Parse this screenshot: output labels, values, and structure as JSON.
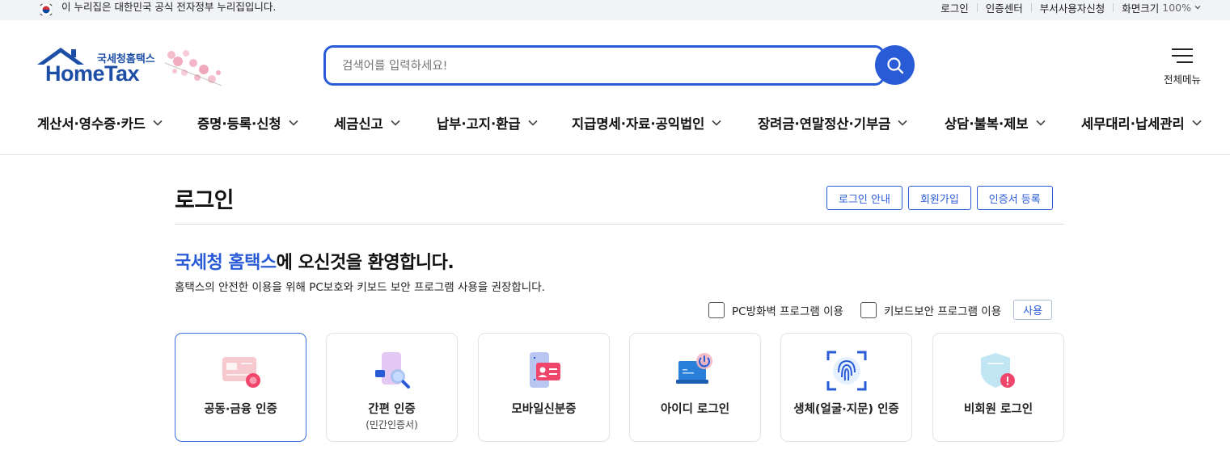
{
  "gov_bar": {
    "notice": "이 누리집은 대한민국 공식 전자정부 누리집입니다.",
    "links": [
      "로그인",
      "인증센터",
      "부서사용자신청"
    ],
    "zoom_label": "화면크기",
    "zoom_value": "100%"
  },
  "header": {
    "logo_small": "국세청홈택스",
    "logo_main": "HomeTax",
    "search_placeholder": "검색어를 입력하세요!",
    "all_menu_label": "전체메뉴"
  },
  "nav": {
    "items": [
      "계산서·영수증·카드",
      "증명·등록·신청",
      "세금신고",
      "납부·고지·환급",
      "지급명세·자료·공익법인",
      "장려금·연말정산·기부금",
      "상담·불복·제보",
      "세무대리·납세관리"
    ]
  },
  "page": {
    "title": "로그인",
    "buttons": [
      "로그인 안내",
      "회원가입",
      "인증서 등록"
    ],
    "welcome_highlight": "국세청 홈택스",
    "welcome_rest": "에 오신것을 환영합니다.",
    "subtext": "홈택스의 안전한 이용을 위해 PC보호와 키보드 보안 프로그램 사용을 권장합니다.",
    "security": {
      "firewall_label": "PC방화벽 프로그램 이용",
      "keyboard_label": "키보드보안 프로그램 이용",
      "use_button": "사용"
    }
  },
  "login_methods": [
    {
      "label": "공동·금융 인증",
      "sub": "",
      "icon": "certificate-card-icon",
      "selected": true
    },
    {
      "label": "간편 인증",
      "sub": "(민간인증서)",
      "icon": "phone-search-icon",
      "selected": false
    },
    {
      "label": "모바일신분증",
      "sub": "",
      "icon": "mobile-id-icon",
      "selected": false
    },
    {
      "label": "아이디 로그인",
      "sub": "",
      "icon": "laptop-power-icon",
      "selected": false
    },
    {
      "label": "생체(얼굴·지문) 인증",
      "sub": "",
      "icon": "fingerprint-icon",
      "selected": false
    },
    {
      "label": "비회원 로그인",
      "sub": "",
      "icon": "shield-lock-icon",
      "selected": false
    }
  ],
  "colors": {
    "accent": "#2a5bd7",
    "govbar_bg": "#f1f3f7",
    "logo_navy": "#1d4ea6"
  }
}
